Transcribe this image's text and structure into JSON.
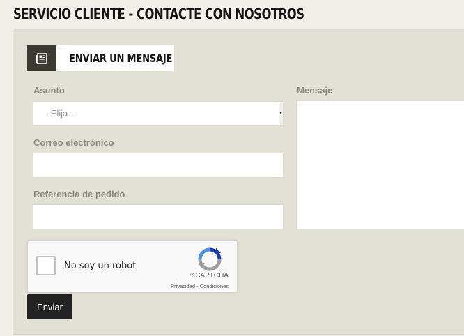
{
  "page": {
    "title": "SERVICIO CLIENTE - CONTACTE CON NOSOTROS"
  },
  "section": {
    "title": "ENVIAR UN MENSAJE",
    "icon": "newspaper-icon"
  },
  "form": {
    "subject": {
      "label": "Asunto",
      "selected": "--Elija--"
    },
    "email": {
      "label": "Correo electrónico",
      "value": ""
    },
    "order_reference": {
      "label": "Referencia de pedido",
      "value": ""
    },
    "message": {
      "label": "Mensaje",
      "value": ""
    },
    "submit_label": "Enviar"
  },
  "recaptcha": {
    "checkbox_label": "No soy un robot",
    "brand": "reCAPTCHA",
    "links": "Privacidad - Condiciones",
    "checked": false
  },
  "colors": {
    "page_background": "#f1efe7",
    "panel_background": "#e2e1d6",
    "header_icon_background": "#3b3b31",
    "button_background": "#222222",
    "label_text": "#8a8a80"
  }
}
